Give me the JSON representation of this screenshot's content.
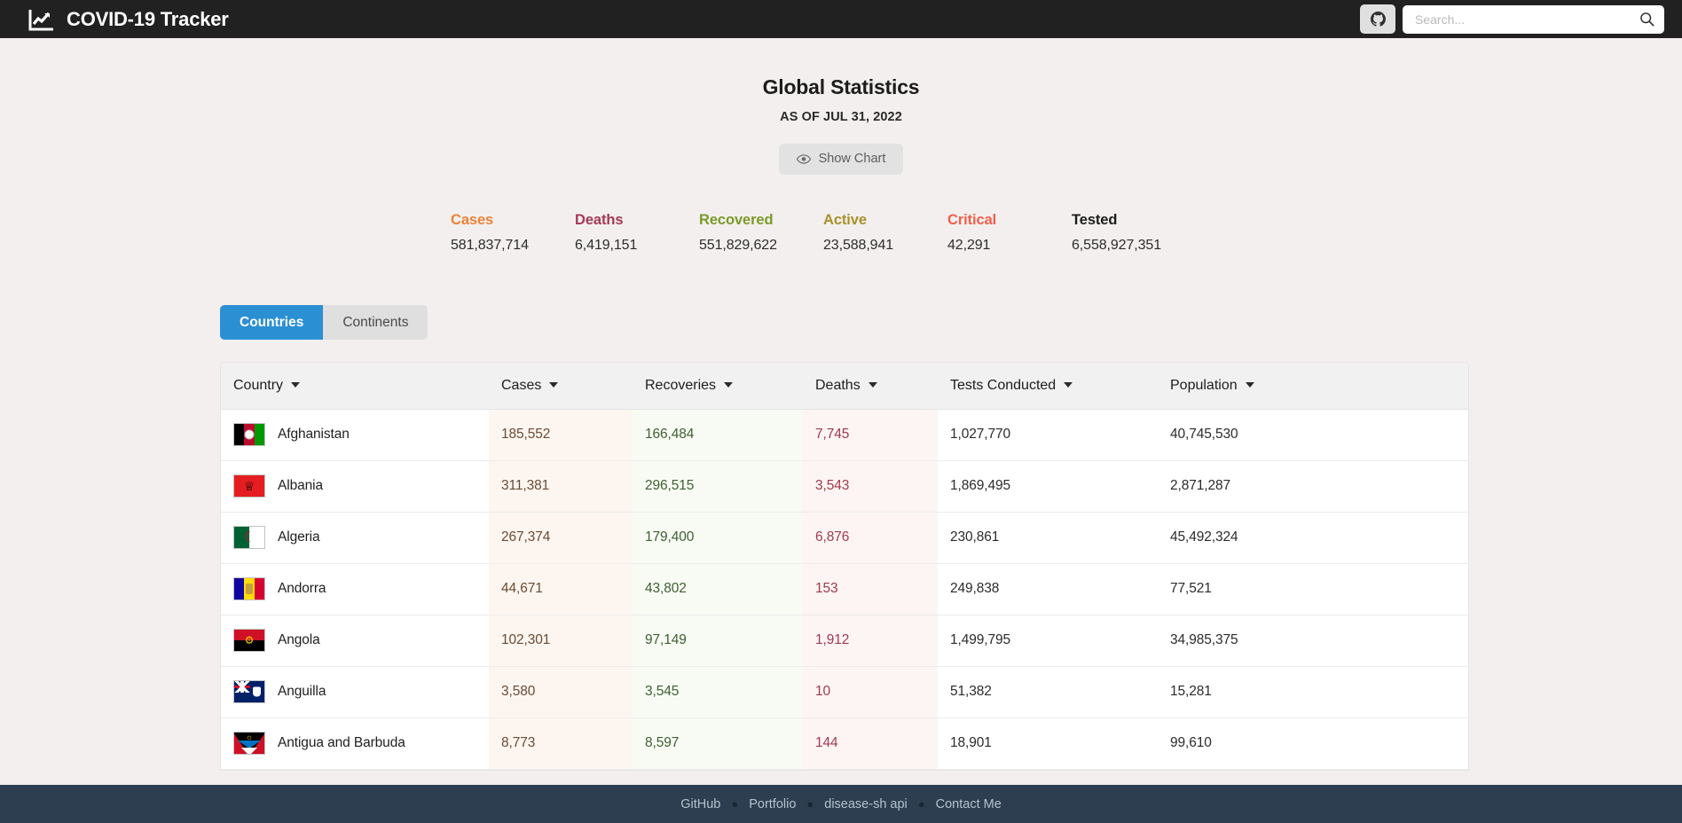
{
  "header": {
    "brand_title": "COVID-19 Tracker",
    "logo_icon": "chart-line-icon",
    "github_icon": "github-icon",
    "search_placeholder": "Search...",
    "search_value": "",
    "search_icon": "search-icon",
    "background": "#212121"
  },
  "global": {
    "title": "Global Statistics",
    "as_of": "AS OF JUL 31, 2022",
    "chart_button_label": "Show Chart",
    "chart_button_icon": "eye-icon",
    "stats": [
      {
        "label": "Cases",
        "value": "581,837,714",
        "color": "#e8833a"
      },
      {
        "label": "Deaths",
        "value": "6,419,151",
        "color": "#a33a55"
      },
      {
        "label": "Recovered",
        "value": "551,829,622",
        "color": "#7a9b2a"
      },
      {
        "label": "Active",
        "value": "23,588,941",
        "color": "#a8922b"
      },
      {
        "label": "Critical",
        "value": "42,291",
        "color": "#ef5f4c"
      },
      {
        "label": "Tested",
        "value": "6,558,927,351",
        "color": "#1c1c1c"
      }
    ]
  },
  "tabs": [
    {
      "label": "Countries",
      "active": true
    },
    {
      "label": "Continents",
      "active": false
    }
  ],
  "table": {
    "columns": [
      {
        "key": "country",
        "label": "Country"
      },
      {
        "key": "cases",
        "label": "Cases"
      },
      {
        "key": "recoveries",
        "label": "Recoveries"
      },
      {
        "key": "deaths",
        "label": "Deaths"
      },
      {
        "key": "tests",
        "label": "Tests Conducted"
      },
      {
        "key": "population",
        "label": "Population"
      }
    ],
    "rows": [
      {
        "country": "Afghanistan",
        "cases": "185,552",
        "recoveries": "166,484",
        "deaths": "7,745",
        "tests": "1,027,770",
        "population": "40,745,530",
        "flag": "afghanistan"
      },
      {
        "country": "Albania",
        "cases": "311,381",
        "recoveries": "296,515",
        "deaths": "3,543",
        "tests": "1,869,495",
        "population": "2,871,287",
        "flag": "albania"
      },
      {
        "country": "Algeria",
        "cases": "267,374",
        "recoveries": "179,400",
        "deaths": "6,876",
        "tests": "230,861",
        "population": "45,492,324",
        "flag": "algeria"
      },
      {
        "country": "Andorra",
        "cases": "44,671",
        "recoveries": "43,802",
        "deaths": "153",
        "tests": "249,838",
        "population": "77,521",
        "flag": "andorra"
      },
      {
        "country": "Angola",
        "cases": "102,301",
        "recoveries": "97,149",
        "deaths": "1,912",
        "tests": "1,499,795",
        "population": "34,985,375",
        "flag": "angola"
      },
      {
        "country": "Anguilla",
        "cases": "3,580",
        "recoveries": "3,545",
        "deaths": "10",
        "tests": "51,382",
        "population": "15,281",
        "flag": "anguilla"
      },
      {
        "country": "Antigua and Barbuda",
        "cases": "8,773",
        "recoveries": "8,597",
        "deaths": "144",
        "tests": "18,901",
        "population": "99,610",
        "flag": "antigua"
      }
    ]
  },
  "footer": {
    "links": [
      "GitHub",
      "Portfolio",
      "disease-sh api",
      "Contact Me"
    ],
    "separator": "●",
    "background": "#2c3e50"
  }
}
